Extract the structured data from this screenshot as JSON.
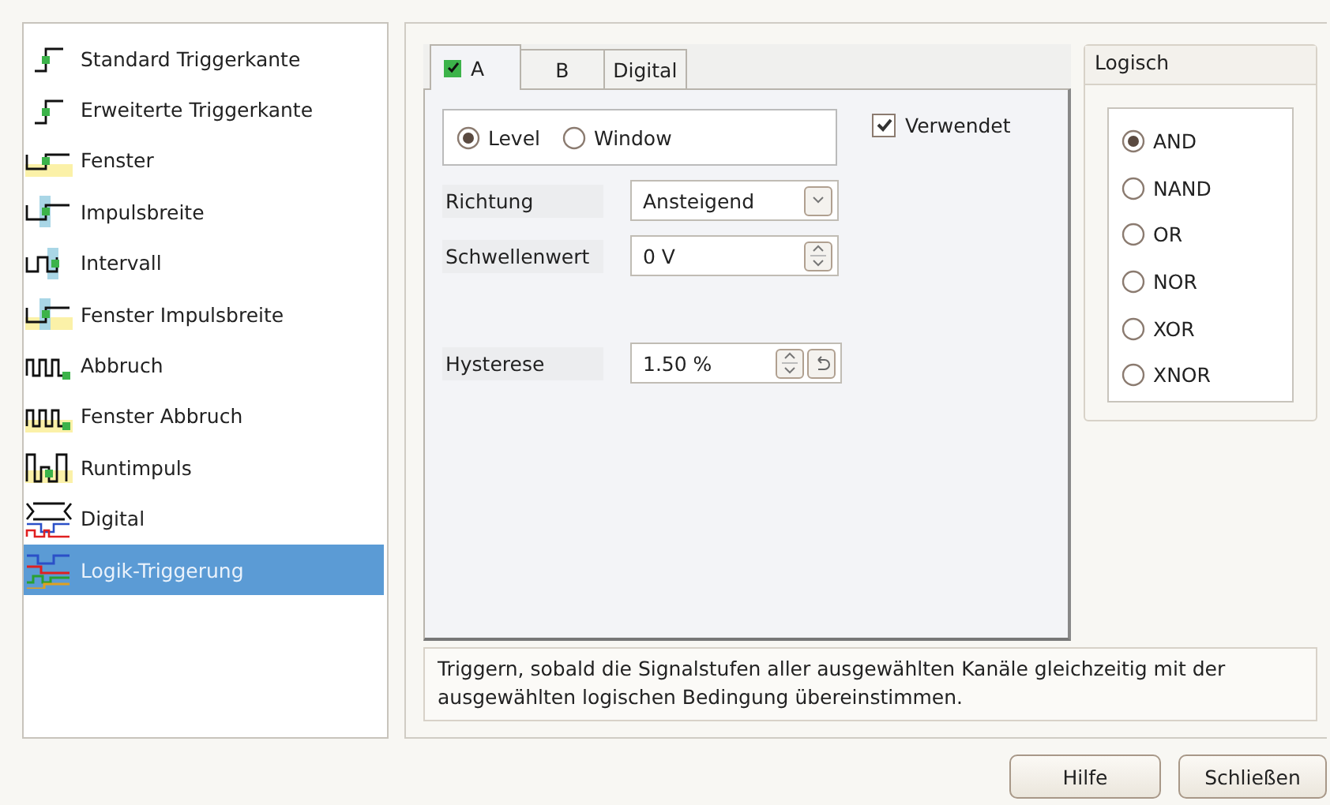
{
  "trigger_types": [
    {
      "label": "Standard Triggerkante",
      "kind": "edge",
      "selected": false
    },
    {
      "label": "Erweiterte Triggerkante",
      "kind": "edge",
      "selected": false
    },
    {
      "label": "Fenster",
      "kind": "window",
      "selected": false
    },
    {
      "label": "Impulsbreite",
      "kind": "pulse",
      "selected": false
    },
    {
      "label": "Intervall",
      "kind": "interval",
      "selected": false
    },
    {
      "label": "Fenster Impulsbreite",
      "kind": "window-pulse",
      "selected": false
    },
    {
      "label": "Abbruch",
      "kind": "dropout",
      "selected": false
    },
    {
      "label": "Fenster Abbruch",
      "kind": "window-dropout",
      "selected": false
    },
    {
      "label": "Runtimpuls",
      "kind": "runt",
      "selected": false
    },
    {
      "label": "Digital",
      "kind": "digital",
      "selected": false
    },
    {
      "label": "Logik-Triggerung",
      "kind": "logic",
      "selected": true
    }
  ],
  "tabs": [
    {
      "label": "A",
      "selected": true,
      "checked": true
    },
    {
      "label": "B",
      "selected": false
    },
    {
      "label": "Digital",
      "selected": false
    }
  ],
  "mode": [
    {
      "label": "Level",
      "selected": true
    },
    {
      "label": "Window",
      "selected": false
    }
  ],
  "used": {
    "label": "Verwendet",
    "checked": true
  },
  "fields": [
    {
      "label": "Richtung",
      "value": "Ansteigend",
      "kind": "dropdown"
    },
    {
      "label": "Schwellenwert",
      "value": "0 V",
      "kind": "spin"
    },
    {
      "label": "Hysterese",
      "value": "1.50 %",
      "kind": "spin-reset"
    }
  ],
  "logic": {
    "title": "Logisch",
    "options": [
      {
        "label": "AND",
        "selected": true
      },
      {
        "label": "NAND",
        "selected": false
      },
      {
        "label": "OR",
        "selected": false
      },
      {
        "label": "NOR",
        "selected": false
      },
      {
        "label": "XOR",
        "selected": false
      },
      {
        "label": "XNOR",
        "selected": false
      }
    ]
  },
  "description": "Triggern, sobald die Signalstufen aller ausgewählten Kanäle gleichzeitig mit der ausgewählten logischen Bedingung übereinstimmen.",
  "buttons": [
    {
      "label": "Hilfe"
    },
    {
      "label": "Schließen"
    }
  ]
}
